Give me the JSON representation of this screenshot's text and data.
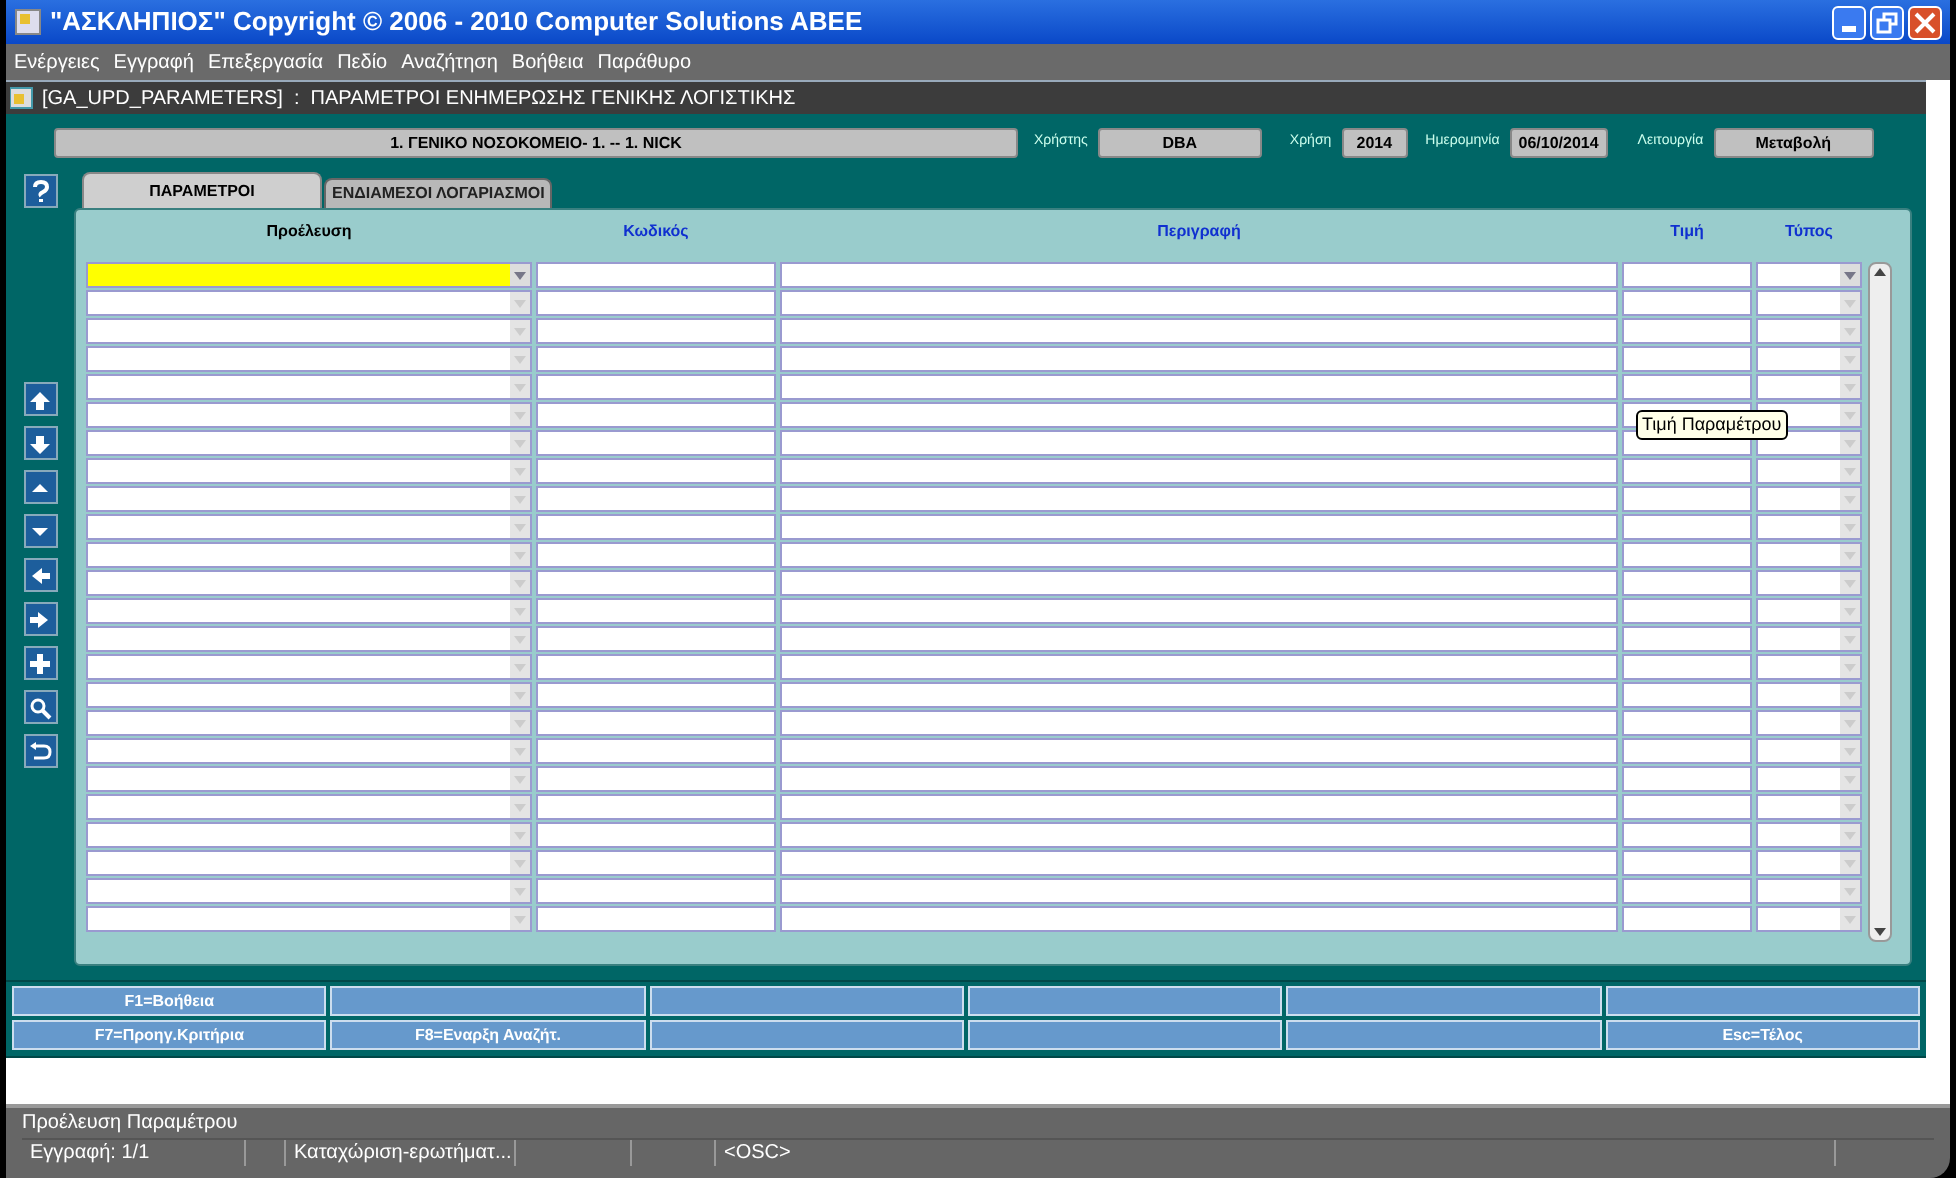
{
  "window": {
    "title": "\"ΑΣΚΛΗΠΙΟΣ\" Copyright © 2006 - 2010 Computer Solutions ABEE"
  },
  "menu": [
    "Ενέργειες",
    "Εγγραφή",
    "Επεξεργασία",
    "Πεδίο",
    "Αναζήτηση",
    "Βοήθεια",
    "Παράθυρο"
  ],
  "form": {
    "title": "[GA_UPD_PARAMETERS]  :  ΠΑΡΑΜΕΤΡΟΙ ΕΝΗΜΕΡΩΣΗΣ ΓΕΝΙΚΗΣ ΛΟΓΙΣΤΙΚΗΣ"
  },
  "header": {
    "organization": "1. ΓΕΝΙΚΟ ΝΟΣΟΚΟΜΕΙΟ- 1. -- 1. NICK",
    "fields": [
      {
        "label": "Χρήστης",
        "value": "DBA"
      },
      {
        "label": "Χρήση",
        "value": "2014"
      },
      {
        "label": "Ημερομηνία",
        "value": "06/10/2014"
      },
      {
        "label": "Λειτουργία",
        "value": "Μεταβολή"
      }
    ]
  },
  "tabs": [
    {
      "label": "ΠΑΡΑΜΕΤΡΟΙ",
      "selected": true
    },
    {
      "label": "ΕΝΔΙΑΜΕΣΟΙ ΛΟΓΑΡΙΑΣΜΟΙ",
      "selected": false
    }
  ],
  "table": {
    "columns": [
      {
        "label": "Προέλευση",
        "kind": "dropdown",
        "required": true
      },
      {
        "label": "Κωδικός",
        "kind": "text",
        "required": false
      },
      {
        "label": "Περιγραφή",
        "kind": "text",
        "required": false
      },
      {
        "label": "Τιμή",
        "kind": "text",
        "required": false
      },
      {
        "label": "Τύπος",
        "kind": "dropdown",
        "required": false
      }
    ],
    "rows": [
      {
        "selected": true
      },
      {
        "selected": false
      },
      {
        "selected": false
      },
      {
        "selected": false
      },
      {
        "selected": false
      },
      {
        "selected": false
      },
      {
        "selected": false
      },
      {
        "selected": false
      },
      {
        "selected": false
      },
      {
        "selected": false
      },
      {
        "selected": false
      },
      {
        "selected": false
      },
      {
        "selected": false
      },
      {
        "selected": false
      },
      {
        "selected": false
      },
      {
        "selected": false
      },
      {
        "selected": false
      },
      {
        "selected": false
      },
      {
        "selected": false
      },
      {
        "selected": false
      },
      {
        "selected": false
      },
      {
        "selected": false
      },
      {
        "selected": false
      },
      {
        "selected": false
      }
    ]
  },
  "tooltip": "Τιμή Παραμέτρου",
  "function_keys": [
    [
      {
        "kind": "labeled",
        "label": "F1=Βοήθεια"
      },
      {
        "kind": "blank"
      },
      {
        "kind": "blank"
      },
      {
        "kind": "blank"
      },
      {
        "kind": "blank"
      },
      {
        "kind": "blank"
      }
    ],
    [
      {
        "kind": "labeled",
        "label": "F7=Προηγ.Κριτήρια"
      },
      {
        "kind": "labeled",
        "label": "F8=Εναρξη Αναζήτ."
      },
      {
        "kind": "blank"
      },
      {
        "kind": "blank"
      },
      {
        "kind": "blank"
      },
      {
        "kind": "labeled",
        "label": "Esc=Τέλος"
      }
    ]
  ],
  "status_bar": {
    "hint": "Προέλευση Παραμέτρου",
    "segments": [
      {
        "kind": "text",
        "text": "Εγγραφή: 1/1"
      },
      {
        "kind": "blank"
      },
      {
        "kind": "text",
        "text": "Καταχώριση-ερωτήματ..."
      },
      {
        "kind": "blank"
      },
      {
        "kind": "blank"
      },
      {
        "kind": "text",
        "text": "<OSC>"
      }
    ]
  }
}
